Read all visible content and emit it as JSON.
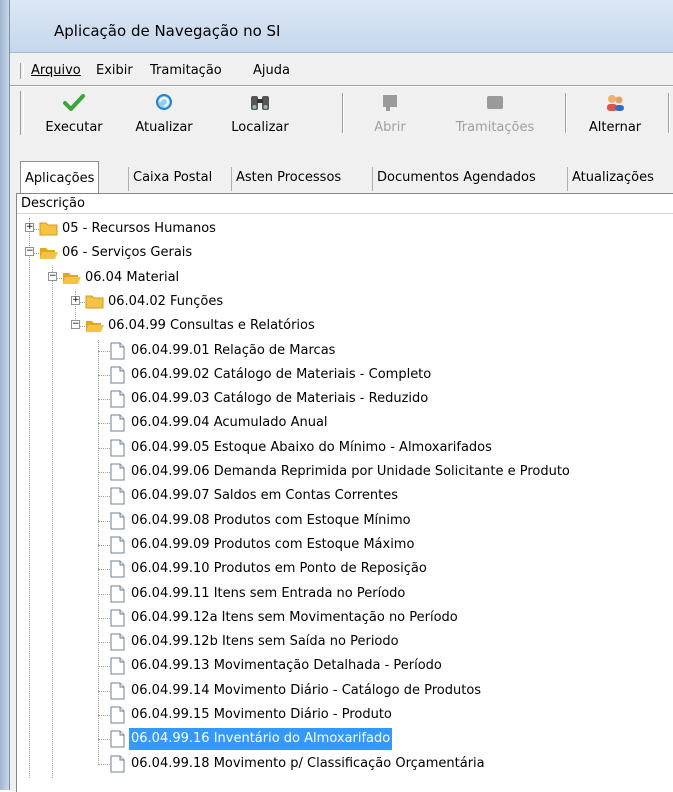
{
  "window": {
    "title": "Aplicação de Navegação no SI"
  },
  "menu": [
    "Arquivo",
    "Exibir",
    "Tramitação",
    "Ajuda"
  ],
  "toolbar": [
    {
      "label": "Executar",
      "icon": "check-icon",
      "enabled": true
    },
    {
      "label": "Atualizar",
      "icon": "refresh-icon",
      "enabled": true
    },
    {
      "label": "Localizar",
      "icon": "binoculars-icon",
      "enabled": true
    },
    {
      "label": "Abrir",
      "icon": "open-icon",
      "enabled": false
    },
    {
      "label": "Tramitações",
      "icon": "tramitacoes-icon",
      "enabled": false
    },
    {
      "label": "Alternar",
      "icon": "users-icon",
      "enabled": true
    }
  ],
  "tabs": [
    "Aplicações",
    "Caixa Postal",
    "Asten Processos",
    "Documentos Agendados",
    "Atualizações"
  ],
  "active_tab": "Aplicações",
  "tree": {
    "column_header": "Descrição",
    "nodes": [
      {
        "label": "05 - Recursos Humanos",
        "level": 0,
        "type": "folder",
        "expander": "+"
      },
      {
        "label": "06 - Serviços Gerais",
        "level": 0,
        "type": "folder-open",
        "expander": "-"
      },
      {
        "label": "06.04 Material",
        "level": 1,
        "type": "folder-open",
        "expander": "-"
      },
      {
        "label": "06.04.02 Funções",
        "level": 2,
        "type": "folder",
        "expander": "+"
      },
      {
        "label": "06.04.99 Consultas e Relatórios",
        "level": 2,
        "type": "folder-open",
        "expander": "-"
      },
      {
        "label": "06.04.99.01 Relação de Marcas",
        "level": 3,
        "type": "doc"
      },
      {
        "label": "06.04.99.02 Catálogo de Materiais - Completo",
        "level": 3,
        "type": "doc"
      },
      {
        "label": "06.04.99.03 Catálogo de Materiais - Reduzido",
        "level": 3,
        "type": "doc"
      },
      {
        "label": "06.04.99.04 Acumulado Anual",
        "level": 3,
        "type": "doc"
      },
      {
        "label": "06.04.99.05 Estoque Abaixo do Mínimo - Almoxarifados",
        "level": 3,
        "type": "doc"
      },
      {
        "label": "06.04.99.06 Demanda Reprimida por Unidade Solicitante e Produto",
        "level": 3,
        "type": "doc"
      },
      {
        "label": "06.04.99.07 Saldos em Contas Correntes",
        "level": 3,
        "type": "doc"
      },
      {
        "label": "06.04.99.08 Produtos com Estoque Mínimo",
        "level": 3,
        "type": "doc"
      },
      {
        "label": "06.04.99.09 Produtos com Estoque Máximo",
        "level": 3,
        "type": "doc"
      },
      {
        "label": "06.04.99.10 Produtos em Ponto de Reposição",
        "level": 3,
        "type": "doc"
      },
      {
        "label": "06.04.99.11 Itens sem Entrada no Período",
        "level": 3,
        "type": "doc"
      },
      {
        "label": "06.04.99.12a Itens sem Movimentação no Período",
        "level": 3,
        "type": "doc"
      },
      {
        "label": "06.04.99.12b Itens sem Saída no Periodo",
        "level": 3,
        "type": "doc"
      },
      {
        "label": "06.04.99.13 Movimentação Detalhada - Período",
        "level": 3,
        "type": "doc"
      },
      {
        "label": "06.04.99.14 Movimento Diário - Catálogo de Produtos",
        "level": 3,
        "type": "doc"
      },
      {
        "label": "06.04.99.15 Movimento Diário - Produto",
        "level": 3,
        "type": "doc"
      },
      {
        "label": "06.04.99.16 Inventário do Almoxarifado",
        "level": 3,
        "type": "doc",
        "selected": true
      },
      {
        "label": "06.04.99.18 Movimento p/ Classificação Orçamentária",
        "level": 3,
        "type": "doc"
      }
    ]
  },
  "colors": {
    "selection": "#3399ff",
    "folder": "#f5c342"
  }
}
